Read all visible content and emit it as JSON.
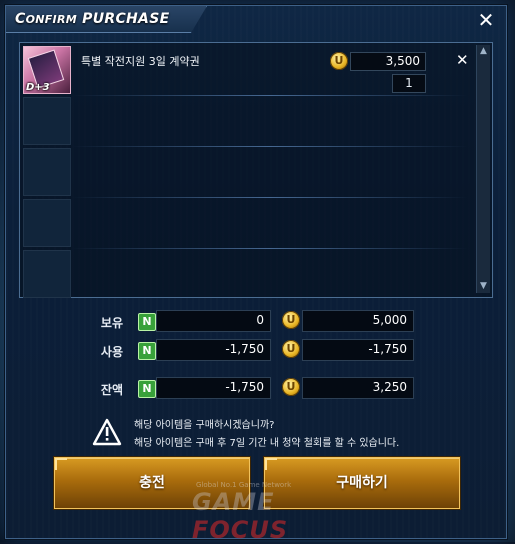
{
  "dialog": {
    "title_first": "C",
    "title_rest": "ONFIRM",
    "title_second": "PURCHASE",
    "close_label": "✕"
  },
  "item": {
    "name": "특별 작전지원 3일 계약권",
    "badge": "D+3",
    "price": "3,500",
    "quantity": "1",
    "remove_label": "✕"
  },
  "totals": {
    "rows": [
      {
        "label": "보유",
        "currency_n": "0",
        "currency_u": "5,000"
      },
      {
        "label": "사용",
        "currency_n": "-1,750",
        "currency_u": "-1,750"
      },
      {
        "label": "잔액",
        "currency_n": "-1,750",
        "currency_u": "3,250"
      }
    ],
    "n_badge": "N"
  },
  "notice": {
    "line1": "해당 아이템을 구매하시겠습니까?",
    "line2": "해당 아이템은 구매 후 7일 기간 내 청약 철회를 할 수 있습니다."
  },
  "buttons": {
    "charge": "충전",
    "buy": "구매하기"
  },
  "watermark": {
    "small": "Global No.1 Game Network",
    "game": "GAME",
    "focus": "FOCUS"
  },
  "colors": {
    "coin_gold": "#e9b523",
    "n_green": "#38a13a",
    "button_gold": "#d79a22",
    "panel_blue": "#0f2744"
  }
}
